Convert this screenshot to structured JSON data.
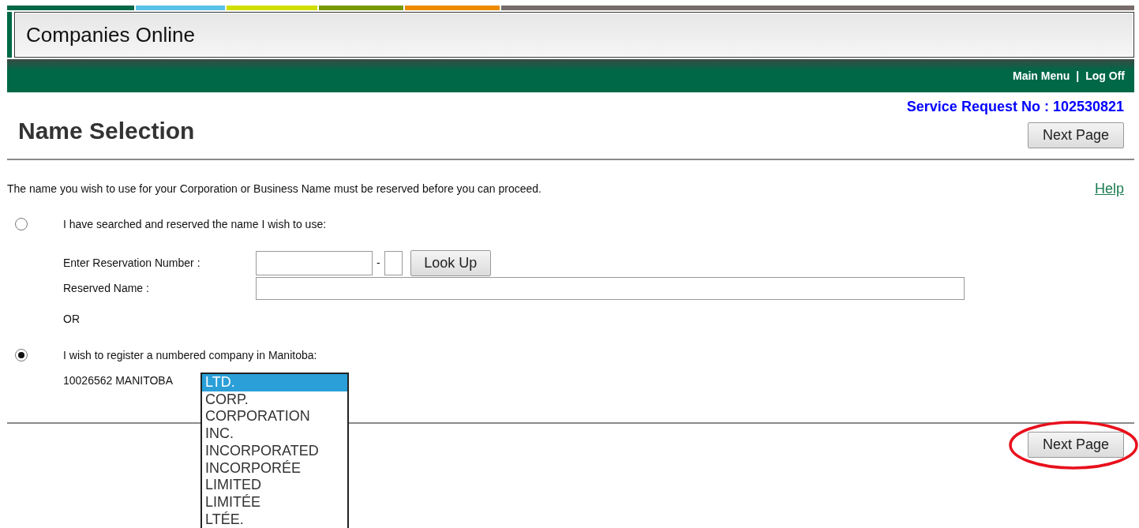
{
  "header": {
    "title": "Companies Online"
  },
  "nav": {
    "links": [
      "Main Menu",
      "Log Off"
    ],
    "separator": "|"
  },
  "service_request": "Service Request No : 102530821",
  "page_title": "Name Selection",
  "next_buttons": [
    {
      "label": "Next Page",
      "annotated": false
    },
    {
      "label": "Next Page",
      "annotated": true
    }
  ],
  "intro": "The name you wish to use for your Corporation or Business Name must be reserved before you can proceed.",
  "help_link": "Help",
  "options": [
    {
      "label": "I have searched and reserved the name I wish to use:",
      "selected": false
    },
    {
      "label": "I wish to register a numbered company in Manitoba:",
      "selected": true
    }
  ],
  "reservation": {
    "number_label": "Enter Reservation Number :",
    "dash": "-",
    "lookup_button": "Look Up",
    "name_label": "Reserved Name :"
  },
  "or_text": "OR",
  "numbered": {
    "name": "10026562 MANITOBA",
    "suffix_options": [
      {
        "label": "LTD.",
        "selected": true
      },
      {
        "label": "CORP.",
        "selected": false
      },
      {
        "label": "CORPORATION",
        "selected": false
      },
      {
        "label": "INC.",
        "selected": false
      },
      {
        "label": "INCORPORATED",
        "selected": false
      },
      {
        "label": "INCORPORÉE",
        "selected": false
      },
      {
        "label": "LIMITED",
        "selected": false
      },
      {
        "label": "LIMITÉE",
        "selected": false
      },
      {
        "label": "LTÉE.",
        "selected": false
      }
    ]
  }
}
